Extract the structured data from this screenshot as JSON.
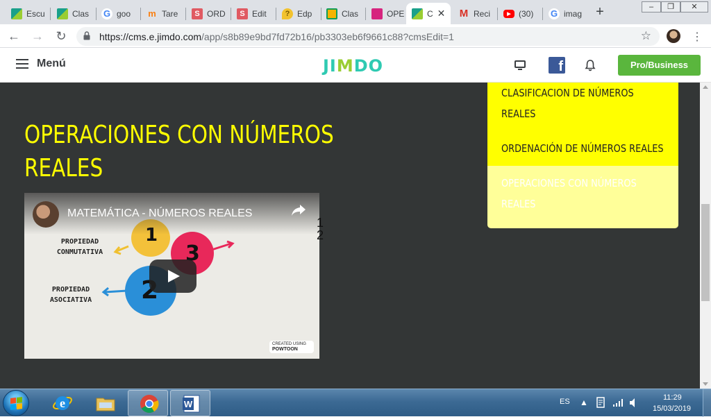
{
  "browser": {
    "tabs": [
      {
        "label": "Escu",
        "favicon": "jimdo-icon"
      },
      {
        "label": "Clas",
        "favicon": "jimdo-icon"
      },
      {
        "label": "goo",
        "favicon": "google-icon"
      },
      {
        "label": "Tare",
        "favicon": "moodle-icon"
      },
      {
        "label": "ORD",
        "favicon": "s-icon"
      },
      {
        "label": "Edit",
        "favicon": "s-icon"
      },
      {
        "label": "Edp",
        "favicon": "edpuzzle-icon"
      },
      {
        "label": "Clas",
        "favicon": "classroom-icon"
      },
      {
        "label": "OPE",
        "favicon": "pink-icon"
      },
      {
        "label": "C",
        "favicon": "jimdo-icon"
      },
      {
        "label": "Reci",
        "favicon": "gmail-icon"
      },
      {
        "label": "(30)",
        "favicon": "youtube-icon"
      },
      {
        "label": "imag",
        "favicon": "google-icon"
      }
    ],
    "url_host": "https://cms.e.jimdo.com",
    "url_path": "/app/s8b89e9bd7fd72b16/pb3303eb6f9661c88?cmsEdit=1"
  },
  "jimdo": {
    "menu_label": "Menú",
    "logo_text": [
      "JI",
      "M",
      "DO"
    ],
    "pro_button": "Pro/Business"
  },
  "page": {
    "title": [
      "OPERACIONES CON NÚMEROS",
      "REALES"
    ],
    "overflow_text": [
      "1",
      "2"
    ]
  },
  "video": {
    "title": "MATEMÁTICA - NÚMEROS REALES",
    "label_1": [
      "PROPIEDAD",
      "CONMUTATIVA"
    ],
    "label_2": [
      "PROPIEDAD",
      "ASOCIATIVA"
    ],
    "numbers": [
      "1",
      "2",
      "3"
    ],
    "watermark_small": "CREATED USING",
    "watermark": "POWTOON"
  },
  "nav": {
    "items": [
      {
        "label": [
          "CLASIFICACION DE NÚMEROS",
          "REALES"
        ]
      },
      {
        "label": [
          "ORDENACIÓN DE NÚMEROS REALES"
        ]
      },
      {
        "label": [
          "OPERACIONES CON NÚMEROS",
          "REALES"
        ],
        "current": true
      }
    ],
    "colors": {
      "item_bg": "#ffff00",
      "current_bg": "#ffff99",
      "title": "#ffff00",
      "page_bg": "#333636"
    }
  },
  "taskbar": {
    "language": "ES",
    "time": "11:29",
    "date": "15/03/2019"
  }
}
